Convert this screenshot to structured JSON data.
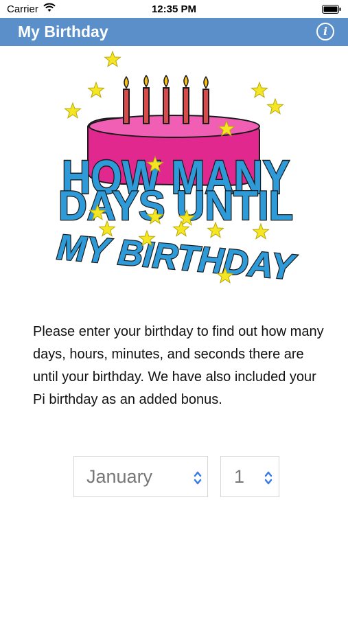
{
  "status_bar": {
    "carrier": "Carrier",
    "time": "12:35 PM"
  },
  "navbar": {
    "title": "My Birthday",
    "info_icon": "info-circle-icon"
  },
  "hero": {
    "line1": "HOW MANY",
    "line2": "DAYS UNTIL",
    "line3": "MY BIRTHDAY"
  },
  "intro_text": "Please enter your birthday to find out how many days, hours, minutes, and seconds there are until your birthday. We have also included your Pi birthday as an added bonus.",
  "month_picker": {
    "value": "January",
    "icon": "up-down-chevron-icon"
  },
  "day_picker": {
    "value": "1",
    "icon": "up-down-chevron-icon"
  },
  "colors": {
    "navbar": "#5a8fca",
    "cake": "#e0288f",
    "text_blue": "#2e9ad8",
    "star": "#f4e622",
    "arrow": "#3b7be8"
  }
}
